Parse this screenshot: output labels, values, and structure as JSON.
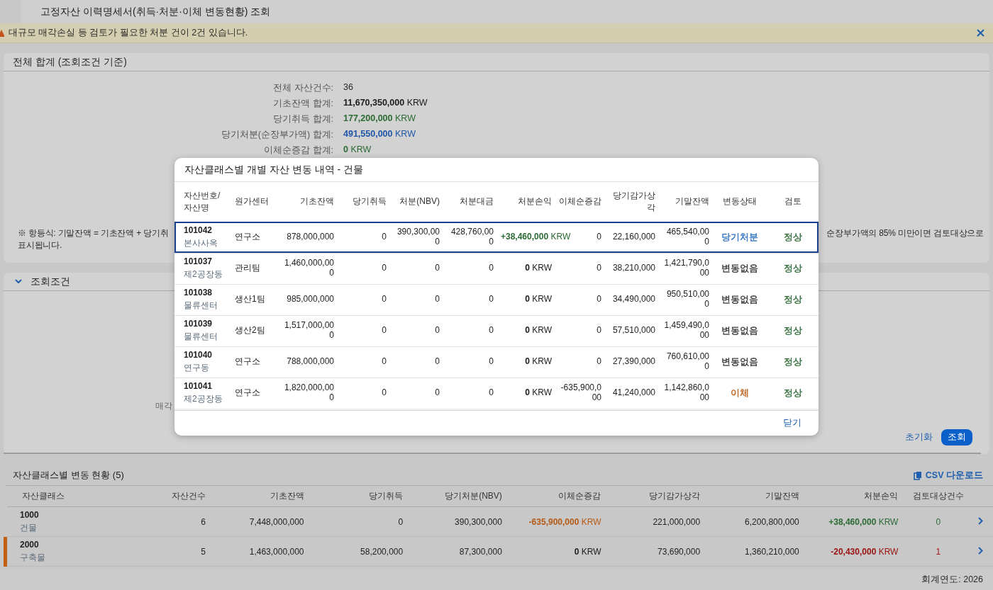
{
  "page_title": "고정자산 이력명세서(취득·처분·이체 변동현황) 조회",
  "alert": {
    "message": "대규모 매각손실 등 검토가 필요한 처분 건이 2건 있습니다."
  },
  "summary": {
    "title": "전체 합계 (조회조건 기준)",
    "rows": [
      {
        "label": "전체 자산건수:",
        "value": "36",
        "color": "#2a2a2a"
      },
      {
        "label": "기초잔액 합계:",
        "value": "11,670,350,000",
        "unit": "KRW",
        "color": "#1a1a1a"
      },
      {
        "label": "당기취득 합계:",
        "value": "177,200,000",
        "unit": "KRW",
        "color": "#2b6a34"
      },
      {
        "label": "당기처분(순장부가액) 합계:",
        "value": "491,550,000",
        "unit": "KRW",
        "color": "#1f55a8"
      },
      {
        "label": "이체순증감 합계:",
        "value": "0",
        "unit": "KRW",
        "color": "#2b6a34"
      }
    ],
    "note_left": "※ 항등식: 기말잔액 = 기초잔액 + 당기취",
    "note_right": "순장부가액의 85% 미만이면 검토대상으로",
    "note_end": "표시됩니다."
  },
  "filter": {
    "title": "조회조건",
    "expanded": true,
    "field_label": "매각",
    "reset_button": "초기화",
    "search_button": "조회"
  },
  "class_table": {
    "title": "자산클래스별 변동 현황 (5)",
    "download": "CSV 다운로드",
    "columns": [
      "자산클래스",
      "자산건수",
      "기초잔액",
      "당기취득",
      "당기처분(NBV)",
      "이체순증감",
      "당기감가상각",
      "기말잔액",
      "처분손익",
      "검토대상건수"
    ],
    "rows": [
      {
        "code": "1000",
        "name": "건물",
        "count": "6",
        "opening": "7,448,000,000",
        "acquired": "0",
        "disposed": "390,300,000",
        "transfer": {
          "amount": "-635,900,000",
          "unit": "KRW",
          "color": "#b55a14"
        },
        "depreciation": "221,000,000",
        "closing": "6,200,800,000",
        "gain_loss": {
          "amount": "+38,460,000",
          "unit": "KRW",
          "color": "#2b6a34"
        },
        "review": {
          "count": "0",
          "color": "#2b6a34"
        },
        "flagged": false
      },
      {
        "code": "2000",
        "name": "구축물",
        "count": "5",
        "opening": "1,463,000,000",
        "acquired": "58,200,000",
        "disposed": "87,300,000",
        "transfer": {
          "amount": "0",
          "unit": "KRW",
          "color": "#1a1a1a"
        },
        "depreciation": "73,690,000",
        "closing": "1,360,210,000",
        "gain_loss": {
          "amount": "-20,430,000",
          "unit": "KRW",
          "color": "#9a1010"
        },
        "review": {
          "count": "1",
          "color": "#a01818"
        },
        "flagged": true
      }
    ]
  },
  "footer": {
    "fiscal_year": "회계연도: 2026"
  },
  "dialog": {
    "title": "자산클래스별 개별 자산 변동 내역 - 건물",
    "close": "닫기",
    "columns": [
      "자산번호/\n자산명",
      "원가센터",
      "기초잔액",
      "당기취득",
      "처분(NBV)",
      "처분대금",
      "처분손익",
      "이체순증감",
      "당기감가상각",
      "기말잔액",
      "변동상태",
      "검토"
    ],
    "rows": [
      {
        "id": "101042",
        "name": "본사사옥",
        "center": "연구소",
        "opening": "878,000,000",
        "acquired": "0",
        "nbv": "390,300,000",
        "proceeds": "428,760,000",
        "gain_loss": {
          "amount": "+38,460,000",
          "unit": "KRW",
          "color": "#2b6a34"
        },
        "transfer": "0",
        "depreciation": "22,160,000",
        "closing": "465,540,000",
        "status": {
          "text": "당기처분",
          "color": "#2a6fc4"
        },
        "review": {
          "text": "정상",
          "color": "#2b6a34"
        },
        "selected": true
      },
      {
        "id": "101037",
        "name": "제2공장동",
        "center": "관리팀",
        "opening": "1,460,000,000",
        "acquired": "0",
        "nbv": "0",
        "proceeds": "0",
        "gain_loss": {
          "amount": "0",
          "unit": "KRW",
          "color": "#1a1a1a"
        },
        "transfer": "0",
        "depreciation": "38,210,000",
        "closing": "1,421,790,000",
        "status": {
          "text": "변동없음",
          "color": "#333333"
        },
        "review": {
          "text": "정상",
          "color": "#2b6a34"
        },
        "selected": false
      },
      {
        "id": "101038",
        "name": "물류센터",
        "center": "생산1팀",
        "opening": "985,000,000",
        "acquired": "0",
        "nbv": "0",
        "proceeds": "0",
        "gain_loss": {
          "amount": "0",
          "unit": "KRW",
          "color": "#1a1a1a"
        },
        "transfer": "0",
        "depreciation": "34,490,000",
        "closing": "950,510,000",
        "status": {
          "text": "변동없음",
          "color": "#333333"
        },
        "review": {
          "text": "정상",
          "color": "#2b6a34"
        },
        "selected": false
      },
      {
        "id": "101039",
        "name": "물류센터",
        "center": "생산2팀",
        "opening": "1,517,000,000",
        "acquired": "0",
        "nbv": "0",
        "proceeds": "0",
        "gain_loss": {
          "amount": "0",
          "unit": "KRW",
          "color": "#1a1a1a"
        },
        "transfer": "0",
        "depreciation": "57,510,000",
        "closing": "1,459,490,000",
        "status": {
          "text": "변동없음",
          "color": "#333333"
        },
        "review": {
          "text": "정상",
          "color": "#2b6a34"
        },
        "selected": false
      },
      {
        "id": "101040",
        "name": "연구동",
        "center": "연구소",
        "opening": "788,000,000",
        "acquired": "0",
        "nbv": "0",
        "proceeds": "0",
        "gain_loss": {
          "amount": "0",
          "unit": "KRW",
          "color": "#1a1a1a"
        },
        "transfer": "0",
        "depreciation": "27,390,000",
        "closing": "760,610,000",
        "status": {
          "text": "변동없음",
          "color": "#333333"
        },
        "review": {
          "text": "정상",
          "color": "#2b6a34"
        },
        "selected": false
      },
      {
        "id": "101041",
        "name": "제2공장동",
        "center": "연구소",
        "opening": "1,820,000,000",
        "acquired": "0",
        "nbv": "0",
        "proceeds": "0",
        "gain_loss": {
          "amount": "0",
          "unit": "KRW",
          "color": "#1a1a1a"
        },
        "transfer": "-635,900,000",
        "depreciation": "41,240,000",
        "closing": "1,142,860,000",
        "status": {
          "text": "이체",
          "color": "#b55a14"
        },
        "review": {
          "text": "정상",
          "color": "#2b6a34"
        },
        "selected": false
      }
    ]
  }
}
